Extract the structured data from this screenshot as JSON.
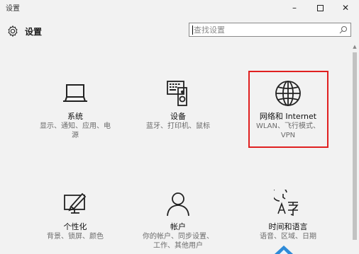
{
  "window": {
    "title": "设置",
    "minimize_glyph": "–",
    "close_glyph": "✕"
  },
  "header": {
    "title": "设置",
    "search_placeholder": "查找设置"
  },
  "tiles": [
    {
      "name": "系统",
      "desc": "显示、通知、应用、电源",
      "icon": "laptop-icon"
    },
    {
      "name": "设备",
      "desc": "蓝牙、打印机、鼠标",
      "icon": "keyboard-speaker-icon"
    },
    {
      "name": "网络和 Internet",
      "desc": "WLAN、飞行模式、VPN",
      "icon": "globe-icon"
    },
    {
      "name": "个性化",
      "desc": "背景、锁屏、颜色",
      "icon": "personalization-icon"
    },
    {
      "name": "帐户",
      "desc": "你的帐户、同步设置、工作、其他用户",
      "icon": "person-icon"
    },
    {
      "name": "时间和语言",
      "desc": "语音、区域、日期",
      "icon": "time-language-icon"
    }
  ],
  "colors": {
    "background": "#f2f2f2",
    "highlight": "#e02020",
    "accent": "#1e6fc6"
  }
}
